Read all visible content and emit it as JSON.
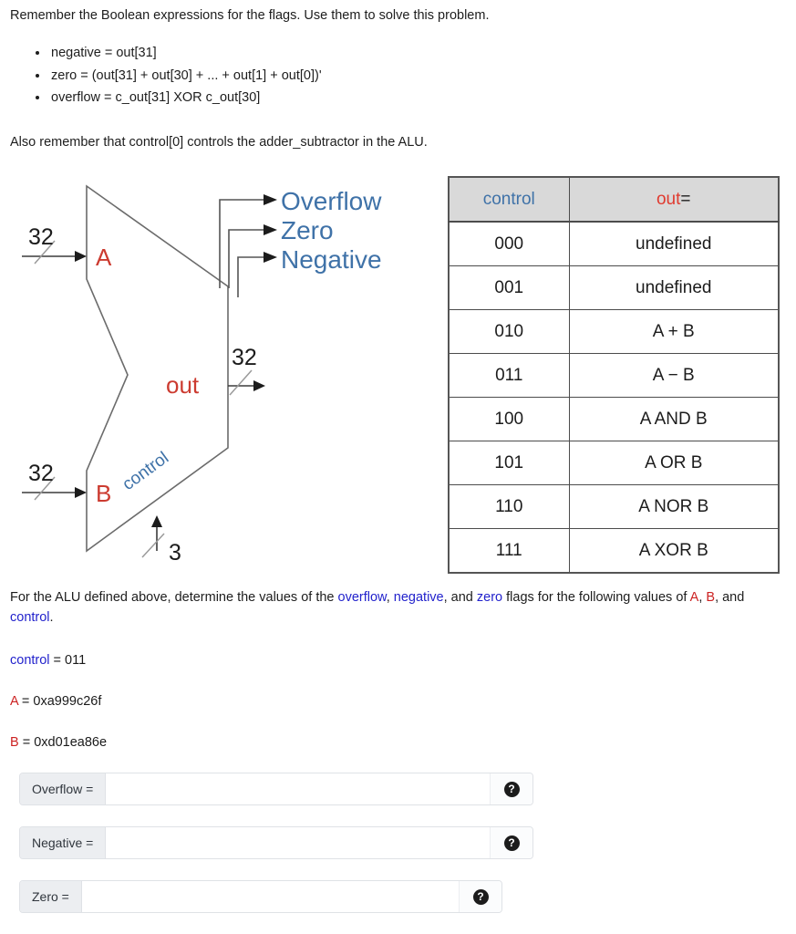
{
  "intro": {
    "text": "Remember the Boolean expressions for the flags. Use them to solve this problem."
  },
  "bullets": [
    "negative = out[31]",
    "zero = (out[31] + out[30] + ... + out[1] + out[0])'",
    "overflow = c_out[31] XOR c_out[30]"
  ],
  "note": {
    "text": "Also remember that control[0] controls the adder_subtractor in the ALU."
  },
  "diagram": {
    "input_a_label": "A",
    "input_b_label": "B",
    "out_label": "out",
    "control_label": "control",
    "bus_a_width": "32",
    "bus_b_width": "32",
    "bus_out_width": "32",
    "bus_control_width": "3",
    "flags": [
      "Overflow",
      "Zero",
      "Negative"
    ],
    "colors": {
      "signal_red": "#cc3b30",
      "signal_blue": "#3f72a8",
      "wire": "#555555"
    }
  },
  "table": {
    "headers": {
      "control": "control",
      "out": "out",
      "out_equals": "="
    },
    "rows": [
      {
        "control": "000",
        "out": "undefined"
      },
      {
        "control": "001",
        "out": "undefined"
      },
      {
        "control": "010",
        "out": "A + B"
      },
      {
        "control": "011",
        "out": "A − B"
      },
      {
        "control": "100",
        "out": "A AND B"
      },
      {
        "control": "101",
        "out": "A OR B"
      },
      {
        "control": "110",
        "out": "A NOR B"
      },
      {
        "control": "111",
        "out": "A XOR B"
      }
    ]
  },
  "question": {
    "part1": "For the ALU defined above, determine the values of the ",
    "flag_overflow": "overflow",
    "sep1": ", ",
    "flag_negative": "negative",
    "sep2": ", and ",
    "flag_zero": "zero",
    "part2": " flags for the following values of ",
    "var_a": "A",
    "sep3": ", ",
    "var_b": "B",
    "sep4": ", and ",
    "var_control": "control",
    "part3": "."
  },
  "values": {
    "control_name": "control",
    "control_value": " = 011",
    "a_name": "A",
    "a_value": " = 0xa999c26f",
    "b_name": "B",
    "b_value": " = 0xd01ea86e"
  },
  "answers": {
    "overflow": {
      "label": "Overflow =",
      "value": "",
      "placeholder": "",
      "help": "?"
    },
    "negative": {
      "label": "Negative =",
      "value": "",
      "placeholder": "",
      "help": "?"
    },
    "zero": {
      "label": "Zero =",
      "value": "",
      "placeholder": "",
      "help": "?"
    }
  }
}
